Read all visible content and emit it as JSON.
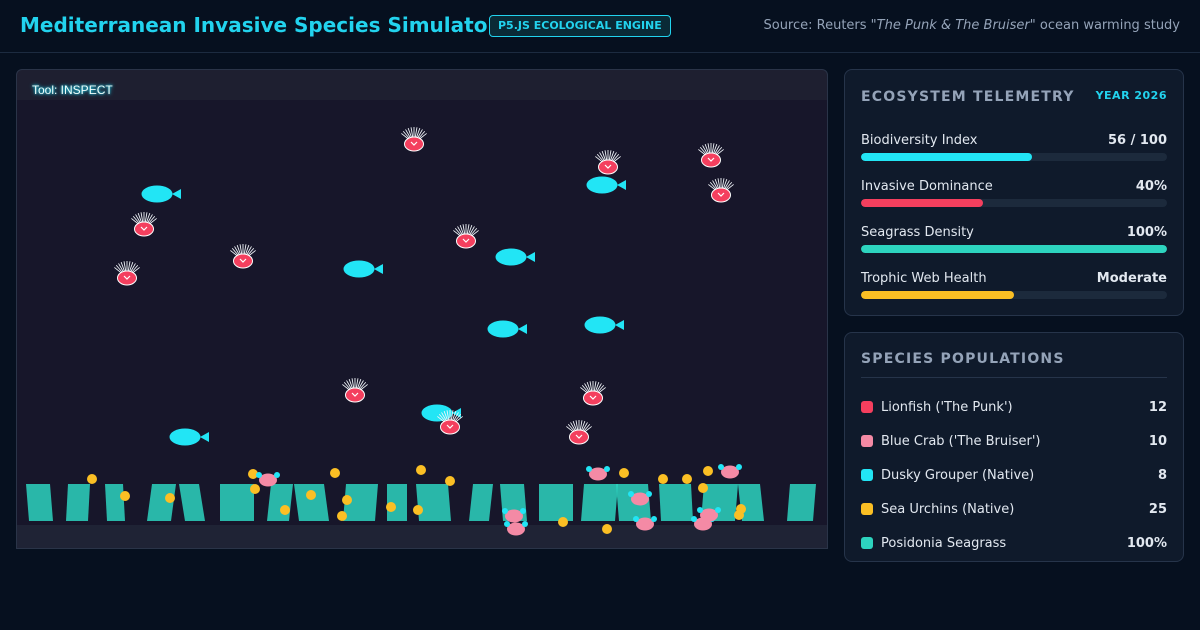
{
  "header": {
    "title": "Mediterranean Invasive Species Simulator",
    "badge": "P5.JS ECOLOGICAL ENGINE",
    "source_prefix": "Source: Reuters \"",
    "source_italic": "The Punk & The Bruiser",
    "source_suffix": "\" ocean warming study"
  },
  "simulation": {
    "tool_label": "Tool: INSPECT"
  },
  "telemetry": {
    "title": "ECOSYSTEM TELEMETRY",
    "year": "YEAR 2026",
    "metrics": [
      {
        "name": "Biodiversity Index",
        "value": "56 / 100",
        "level": 0.56,
        "color": "#22e5f5"
      },
      {
        "name": "Invasive Dominance",
        "value": "40%",
        "level": 0.4,
        "color": "#f43f5e"
      },
      {
        "name": "Seagrass Density",
        "value": "100%",
        "level": 1.0,
        "color": "#2dd4bf"
      },
      {
        "name": "Trophic Web Health",
        "value": "Moderate",
        "level": 0.5,
        "color": "#fbbf24"
      }
    ]
  },
  "populations": {
    "title": "SPECIES POPULATIONS",
    "items": [
      {
        "name": "Lionfish ('The Punk')",
        "count": "12",
        "color": "#f43f5e"
      },
      {
        "name": "Blue Crab ('The Bruiser')",
        "count": "10",
        "color": "#f48aa5"
      },
      {
        "name": "Dusky Grouper (Native)",
        "count": "8",
        "color": "#22e5f5"
      },
      {
        "name": "Sea Urchins (Native)",
        "count": "25",
        "color": "#fbbf24"
      },
      {
        "name": "Posidonia Seagrass",
        "count": "100%",
        "color": "#2dd4bf"
      }
    ]
  }
}
